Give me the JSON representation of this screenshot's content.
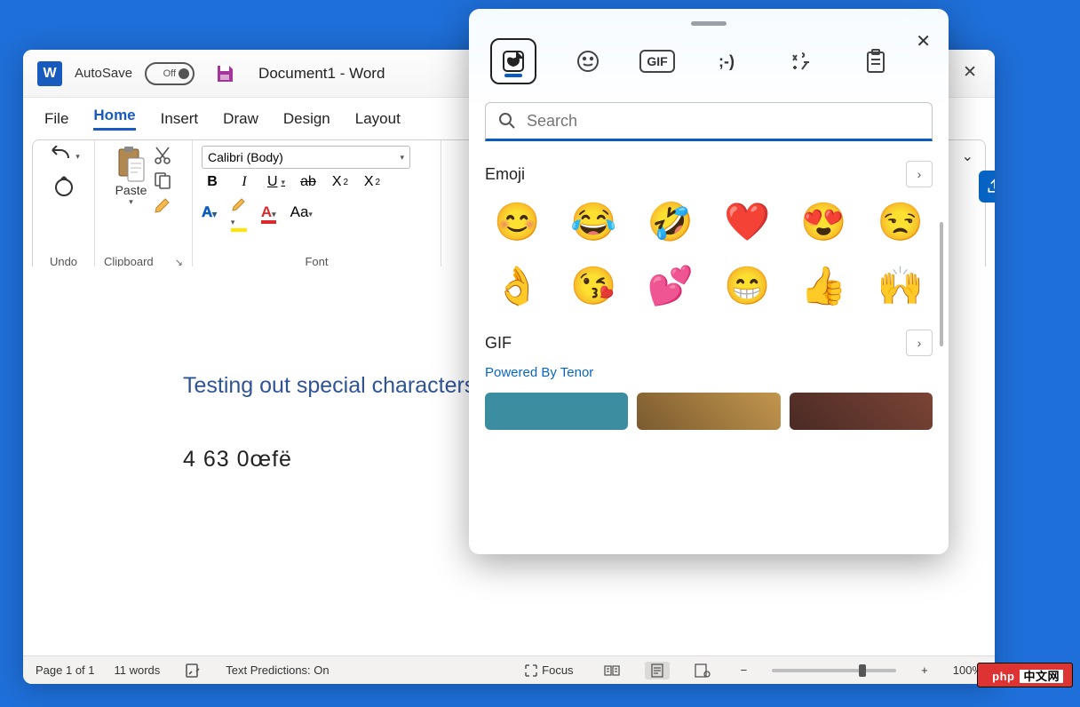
{
  "titlebar": {
    "autosave_label": "AutoSave",
    "autosave_state": "Off",
    "doc_title": "Document1  -  Word"
  },
  "menubar": {
    "items": [
      "File",
      "Home",
      "Insert",
      "Draw",
      "Design",
      "Layout"
    ],
    "active_index": 1
  },
  "ribbon": {
    "undo_group": "Undo",
    "clipboard_group": "Clipboard",
    "paste_label": "Paste",
    "font_group": "Font",
    "font_name": "Calibri (Body)"
  },
  "document": {
    "heading": "Testing out special characters in",
    "body_line": "4 63    0œfë"
  },
  "statusbar": {
    "page": "Page 1 of 1",
    "words": "11 words",
    "text_predictions": "Text Predictions: On",
    "focus": "Focus",
    "zoom": "100%"
  },
  "emoji_panel": {
    "search_placeholder": "Search",
    "section_emoji": "Emoji",
    "section_gif": "GIF",
    "tenor": "Powered By Tenor",
    "tabs": {
      "recent": "recent-sticker",
      "smiley": "smiley",
      "gif": "GIF",
      "kaomoji": ";-)",
      "symbols": "symbols",
      "clipboard": "clipboard"
    },
    "emojis": [
      "😊",
      "😂",
      "🤣",
      "❤️",
      "😍",
      "😒",
      "👌",
      "😘",
      "💕",
      "😁",
      "👍",
      "🙌"
    ]
  },
  "watermark": {
    "left": "php",
    "right": "中文网"
  }
}
